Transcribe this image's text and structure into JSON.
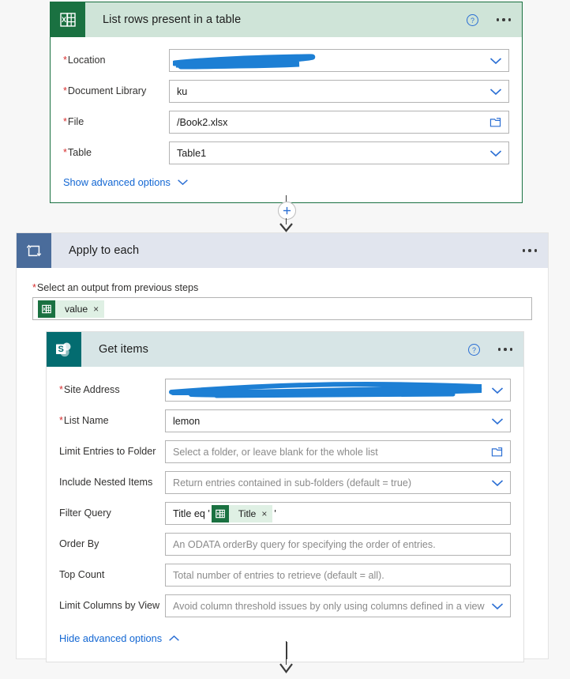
{
  "flow": {
    "excel_card": {
      "icon": "excel-icon",
      "title": "List rows present in a table",
      "help_icon": "help-icon",
      "more_icon": "more-options-icon",
      "accent_color": "#1a7141",
      "header_bg": "#cfe4d8",
      "fields": [
        {
          "label": "Location",
          "required": true,
          "value": "",
          "placeholder": "",
          "control": "dropdown",
          "redacted": true
        },
        {
          "label": "Document Library",
          "required": true,
          "value": "ku",
          "placeholder": "",
          "control": "dropdown",
          "redacted": false
        },
        {
          "label": "File",
          "required": true,
          "value": "/Book2.xlsx",
          "placeholder": "",
          "control": "folder",
          "redacted": false
        },
        {
          "label": "Table",
          "required": true,
          "value": "Table1",
          "placeholder": "",
          "control": "dropdown",
          "redacted": false
        }
      ],
      "advanced_label": "Show advanced options",
      "advanced_state": "collapsed"
    },
    "add_step_button": "add-step-plus-icon",
    "apply_to_each": {
      "icon": "loop-icon",
      "title": "Apply to each",
      "more_icon": "more-options-icon",
      "header_bg": "#e1e5ee",
      "icon_bg": "#4a6c9b",
      "output_label": "Select an output from previous steps",
      "output_required": true,
      "output_token": {
        "icon": "excel-icon",
        "label": "value",
        "remove": "×"
      }
    },
    "sharepoint_card": {
      "icon": "sharepoint-icon",
      "title": "Get items",
      "help_icon": "help-icon",
      "more_icon": "more-options-icon",
      "accent_color": "#036c70",
      "header_bg": "#d7e5e6",
      "fields": [
        {
          "label": "Site Address",
          "required": true,
          "value": "",
          "placeholder": "",
          "control": "dropdown",
          "redacted": true
        },
        {
          "label": "List Name",
          "required": true,
          "value": "lemon",
          "placeholder": "",
          "control": "dropdown",
          "redacted": false
        },
        {
          "label": "Limit Entries to Folder",
          "required": false,
          "value": "",
          "placeholder": "Select a folder, or leave blank for the whole list",
          "control": "folder",
          "redacted": false
        },
        {
          "label": "Include Nested Items",
          "required": false,
          "value": "",
          "placeholder": "Return entries contained in sub-folders (default = true)",
          "control": "dropdown",
          "redacted": false
        },
        {
          "label": "Filter Query",
          "required": false,
          "value": "",
          "placeholder": "",
          "control": "token",
          "redacted": false
        },
        {
          "label": "Order By",
          "required": false,
          "value": "",
          "placeholder": "An ODATA orderBy query for specifying the order of entries.",
          "control": "none",
          "redacted": false
        },
        {
          "label": "Top Count",
          "required": false,
          "value": "",
          "placeholder": "Total number of entries to retrieve (default = all).",
          "control": "none",
          "redacted": false
        },
        {
          "label": "Limit Columns by View",
          "required": false,
          "value": "",
          "placeholder": "Avoid column threshold issues by only using columns defined in a view",
          "control": "dropdown",
          "redacted": false
        }
      ],
      "filter_query": {
        "prefix": "Title eq '",
        "token": {
          "icon": "excel-icon",
          "label": "Title",
          "remove": "×"
        },
        "suffix": "'"
      },
      "advanced_label": "Hide advanced options",
      "advanced_state": "expanded"
    }
  },
  "colors": {
    "excel_green": "#1a7141",
    "sharepoint_teal": "#036c70",
    "loop_blue": "#4a6c9b",
    "link_blue": "#1367d3",
    "required_red": "#d62c2c",
    "redaction_blue": "#1d7fd4",
    "page_bg": "#f7f7f7"
  }
}
